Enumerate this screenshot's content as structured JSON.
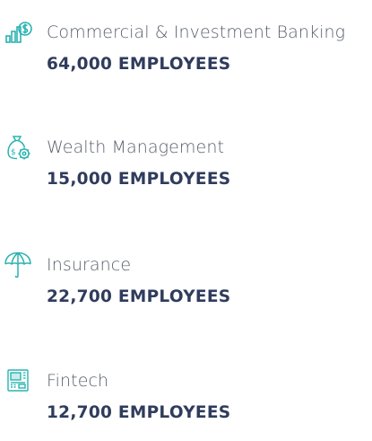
{
  "colors": {
    "icon_teal": "#2ab3b1",
    "label_gray": "#59606b",
    "figure_navy": "#2f3c5c"
  },
  "sectors": [
    {
      "icon": "chart-dollar-icon",
      "name": "Commercial & Investment Banking",
      "employees": "64,000 EMPLOYEES"
    },
    {
      "icon": "money-bag-gear-icon",
      "name": "Wealth Management",
      "employees": "15,000 EMPLOYEES"
    },
    {
      "icon": "umbrella-icon",
      "name": "Insurance",
      "employees": "22,700 EMPLOYEES"
    },
    {
      "icon": "atm-terminal-icon",
      "name": "Fintech",
      "employees": "12,700 EMPLOYEES"
    }
  ]
}
